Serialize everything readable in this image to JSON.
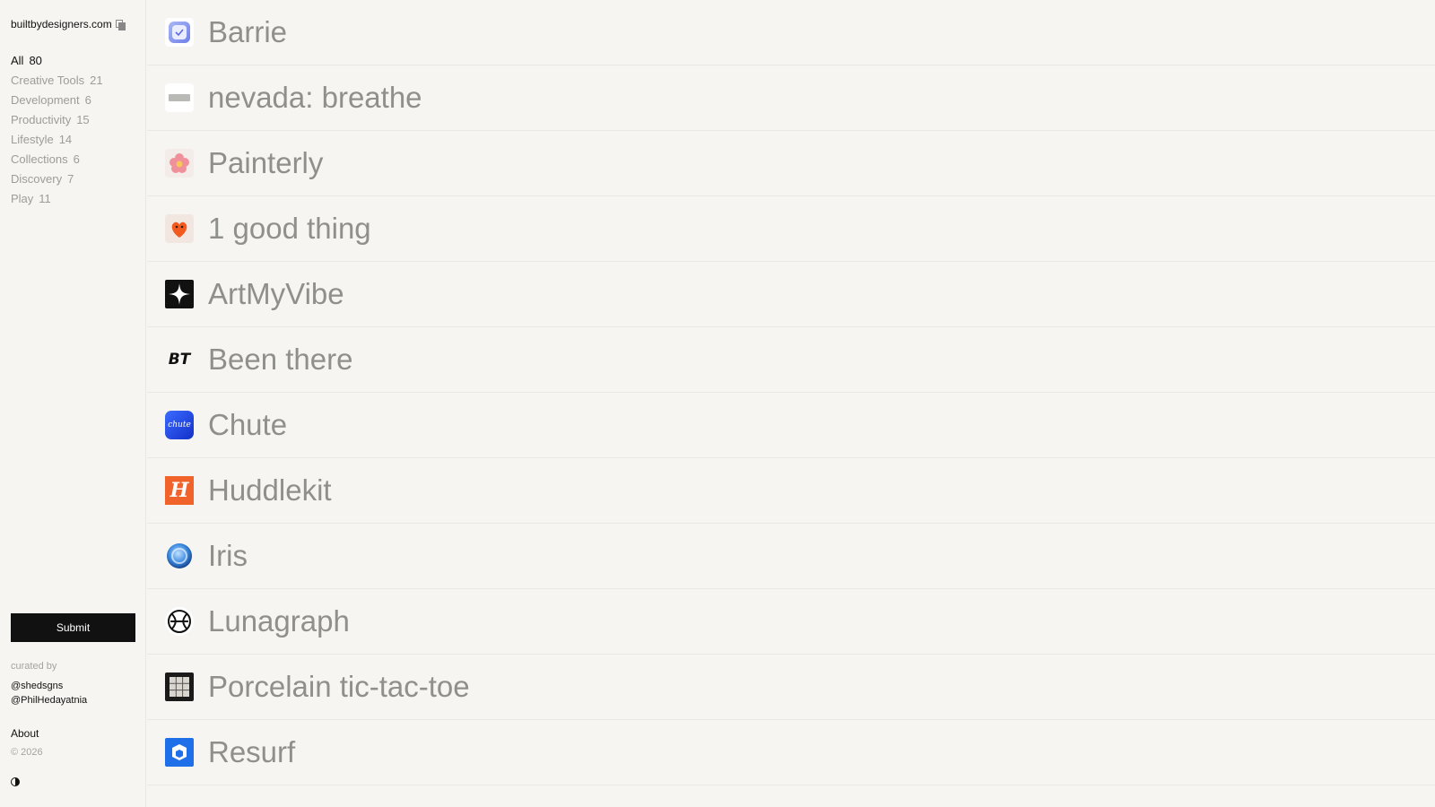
{
  "sidebar": {
    "brand": "builtbydesigners.com",
    "categories": [
      {
        "label": "All",
        "count": "80"
      },
      {
        "label": "Creative Tools",
        "count": "21"
      },
      {
        "label": "Development",
        "count": "6"
      },
      {
        "label": "Productivity",
        "count": "15"
      },
      {
        "label": "Lifestyle",
        "count": "14"
      },
      {
        "label": "Collections",
        "count": "6"
      },
      {
        "label": "Discovery",
        "count": "7"
      },
      {
        "label": "Play",
        "count": "11"
      }
    ],
    "active_category": "All",
    "submit_label": "Submit",
    "curated_label": "curated by",
    "curators": [
      "@shedsgns",
      "@PhilHedayatnia"
    ],
    "about_label": "About",
    "copyright": "© 2026"
  },
  "apps": [
    {
      "name": "Barrie",
      "icon": "barrie-check-icon"
    },
    {
      "name": "nevada: breathe",
      "icon": "nevada-bar-icon"
    },
    {
      "name": "Painterly",
      "icon": "painterly-flower-icon"
    },
    {
      "name": "1 good thing",
      "icon": "one-good-thing-heart-icon"
    },
    {
      "name": "ArtMyVibe",
      "icon": "artmyvibe-sparkle-icon"
    },
    {
      "name": "Been there",
      "icon": "been-there-bt-icon",
      "icon_text": "BT"
    },
    {
      "name": "Chute",
      "icon": "chute-logo-icon",
      "icon_text": "chute"
    },
    {
      "name": "Huddlekit",
      "icon": "huddlekit-h-icon",
      "icon_text": "H"
    },
    {
      "name": "Iris",
      "icon": "iris-globe-icon"
    },
    {
      "name": "Lunagraph",
      "icon": "lunagraph-orb-icon"
    },
    {
      "name": "Porcelain tic-tac-toe",
      "icon": "porcelain-grid-icon"
    },
    {
      "name": "Resurf",
      "icon": "resurf-cube-icon"
    }
  ],
  "colors": {
    "background": "#f6f5f1",
    "divider": "#e9e8e4",
    "text_muted": "#8f8f8c",
    "text_primary": "#111111",
    "submit_bg": "#111111"
  }
}
